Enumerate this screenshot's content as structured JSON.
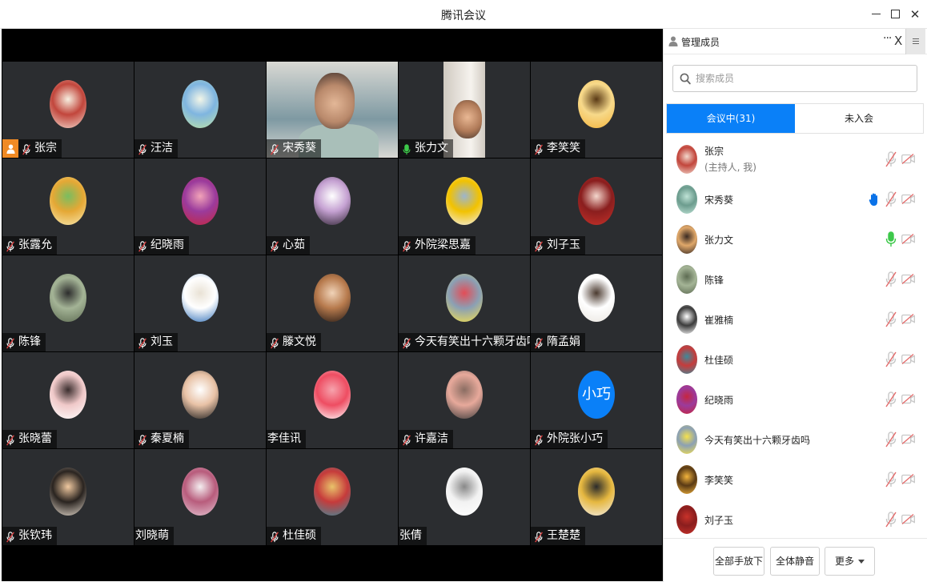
{
  "window": {
    "title": "腾讯会议"
  },
  "colors": {
    "accent": "#0a80f8",
    "tile_bg": "#2b2d30",
    "speaking_green": "#18b15c",
    "host_orange": "#f08a24",
    "muted_red": "#d94040"
  },
  "tiles": [
    {
      "name": "张宗",
      "host": true,
      "muted": true,
      "type": "avatar",
      "palette": [
        "#f2d8cc",
        "#c2463c",
        "#f7efe0"
      ]
    },
    {
      "name": "汪洁",
      "muted": true,
      "type": "avatar",
      "palette": [
        "#bfe3a7",
        "#7fb5e0",
        "#f3f6e8"
      ]
    },
    {
      "name": "宋秀葵",
      "muted": true,
      "type": "video",
      "palette": [
        "#d9d9d4",
        "#7e99a2",
        "#3c2e2a"
      ]
    },
    {
      "name": "张力文",
      "muted": false,
      "speaking": true,
      "type": "video",
      "palette": [
        "#cfc9c0",
        "#f6f3ee",
        "#4a3a32"
      ]
    },
    {
      "name": "李笑笑",
      "muted": true,
      "type": "avatar",
      "palette": [
        "#f3b43c",
        "#f7d98a",
        "#5a3a15"
      ]
    },
    {
      "name": "张露允",
      "muted": true,
      "type": "avatar",
      "palette": [
        "#f7e9b1",
        "#e5a835",
        "#79bd60"
      ]
    },
    {
      "name": "纪晓雨",
      "muted": true,
      "type": "avatar",
      "palette": [
        "#c6263f",
        "#9b3b9c",
        "#f2a3b8"
      ]
    },
    {
      "name": "心茹",
      "muted": true,
      "type": "avatar",
      "palette": [
        "#2f2433",
        "#c5a1d2",
        "#ffffff"
      ]
    },
    {
      "name": "外院梁思嘉",
      "muted": true,
      "type": "avatar",
      "palette": [
        "#f1f0f2",
        "#f2c200",
        "#9db5cd"
      ]
    },
    {
      "name": "刘子玉",
      "muted": true,
      "type": "avatar",
      "palette": [
        "#c8322a",
        "#8a1e1e",
        "#f4d7cd"
      ]
    },
    {
      "name": "陈锋",
      "muted": true,
      "type": "avatar",
      "palette": [
        "#5d6b52",
        "#a4b496",
        "#2d2d2d"
      ]
    },
    {
      "name": "刘玉",
      "muted": true,
      "type": "avatar",
      "palette": [
        "#2f6fb8",
        "#ffffff",
        "#e9e2d5"
      ]
    },
    {
      "name": "滕文悦",
      "muted": true,
      "type": "avatar",
      "palette": [
        "#231915",
        "#b77a4d",
        "#f0d3b8"
      ]
    },
    {
      "name": "今天有笑出十六颗牙齿吗",
      "muted": true,
      "type": "avatar",
      "palette": [
        "#f5e14c",
        "#8ba0b4",
        "#e34d57"
      ]
    },
    {
      "name": "隋孟娟",
      "muted": true,
      "type": "avatar",
      "palette": [
        "#e9e5df",
        "#ffffff",
        "#4b3a2f"
      ]
    },
    {
      "name": "张晓蕾",
      "muted": true,
      "type": "avatar",
      "palette": [
        "#ffffff",
        "#f0c9c9",
        "#3b2e2e"
      ]
    },
    {
      "name": "秦夏楠",
      "muted": true,
      "type": "avatar",
      "palette": [
        "#1c1c1c",
        "#e8c2a6",
        "#ffffff"
      ]
    },
    {
      "name": "李佳讯",
      "muted": null,
      "type": "avatar",
      "palette": [
        "#ffffff",
        "#ee4d62",
        "#f6a3ad"
      ]
    },
    {
      "name": "许嘉洁",
      "muted": true,
      "type": "avatar",
      "palette": [
        "#3b3b3b",
        "#e7a99b",
        "#8a6d62"
      ]
    },
    {
      "name": "外院张小巧",
      "muted": true,
      "type": "text-avatar",
      "initials": "小巧",
      "palette": [
        "#0a80f8"
      ]
    },
    {
      "name": "张钦玮",
      "muted": true,
      "type": "avatar",
      "palette": [
        "#e7dccf",
        "#2a2420",
        "#f0c9a0"
      ]
    },
    {
      "name": "刘晓萌",
      "muted": null,
      "type": "avatar",
      "palette": [
        "#e4c5d3",
        "#b85c7c",
        "#f4eef0"
      ]
    },
    {
      "name": "杜佳硕",
      "muted": true,
      "type": "avatar",
      "palette": [
        "#3d8a9a",
        "#c63b3b",
        "#e9c36a"
      ]
    },
    {
      "name": "张倩",
      "muted": null,
      "type": "avatar",
      "palette": [
        "#ffffff",
        "#f2f2f2",
        "#888888"
      ]
    },
    {
      "name": "王楚楚",
      "muted": true,
      "type": "avatar",
      "palette": [
        "#f2eee8",
        "#e6b840",
        "#2b2b2b"
      ]
    }
  ],
  "panel": {
    "title": "管理成员",
    "more_glyph": "···",
    "close_glyph": "X",
    "search_placeholder": "搜索成员",
    "tabs": [
      {
        "label": "会议中(31)",
        "active": true
      },
      {
        "label": "未入会",
        "active": false
      }
    ],
    "members": [
      {
        "name": "张宗",
        "sub": "(主持人, 我)",
        "mic": "muted",
        "hand": false,
        "palette": [
          "#f2d8cc",
          "#c2463c"
        ]
      },
      {
        "name": "宋秀葵",
        "sub": "",
        "mic": "muted",
        "hand": true,
        "palette": [
          "#bfe3d6",
          "#6c9c8e"
        ]
      },
      {
        "name": "张力文",
        "sub": "",
        "mic": "on",
        "hand": false,
        "palette": [
          "#3a2a22",
          "#e0a86a"
        ]
      },
      {
        "name": "陈锋",
        "sub": "",
        "mic": "muted",
        "hand": false,
        "palette": [
          "#5d6b52",
          "#a4b496"
        ]
      },
      {
        "name": "崔雅楠",
        "sub": "",
        "mic": "muted",
        "hand": false,
        "palette": [
          "#ffffff",
          "#3b3b3b"
        ]
      },
      {
        "name": "杜佳硕",
        "sub": "",
        "mic": "muted",
        "hand": false,
        "palette": [
          "#3d8a9a",
          "#c63b3b"
        ]
      },
      {
        "name": "纪晓雨",
        "sub": "",
        "mic": "muted",
        "hand": false,
        "palette": [
          "#c6263f",
          "#9b3b9c"
        ]
      },
      {
        "name": "今天有笑出十六颗牙齿吗",
        "sub": "",
        "mic": "muted",
        "hand": false,
        "palette": [
          "#f5e14c",
          "#8ba0b4"
        ]
      },
      {
        "name": "李笑笑",
        "sub": "",
        "mic": "muted",
        "hand": false,
        "palette": [
          "#f3b43c",
          "#5a3a15"
        ]
      },
      {
        "name": "刘子玉",
        "sub": "",
        "mic": "muted",
        "hand": false,
        "palette": [
          "#c8322a",
          "#8a1e1e"
        ]
      }
    ],
    "footer": {
      "lower_all_hands": "全部手放下",
      "mute_all": "全体静音",
      "more": "更多"
    }
  }
}
